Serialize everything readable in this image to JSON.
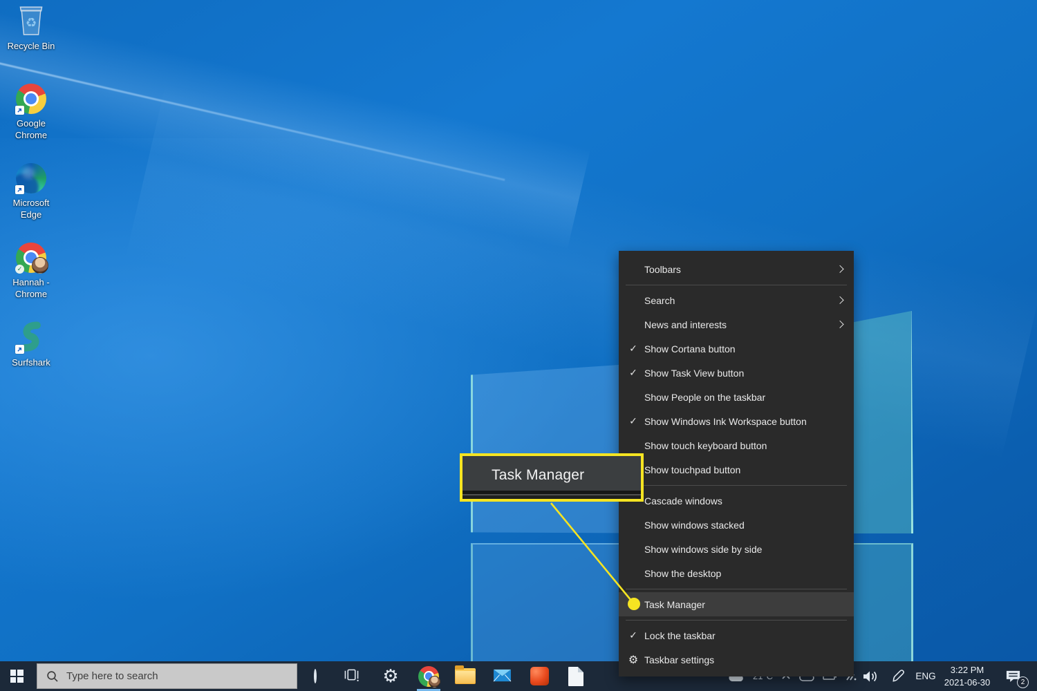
{
  "colors": {
    "accent_yellow": "#f5e422",
    "taskbar_bg": "#1c2939",
    "menu_bg": "#2a2a2a",
    "menu_highlight": "#3d3d3d",
    "active_app_indicator": "#76b9ed"
  },
  "desktop": {
    "icons": [
      {
        "name": "recycle-bin",
        "label": "Recycle Bin",
        "icon": "recycle-bin",
        "overlays": []
      },
      {
        "name": "google-chrome",
        "label": "Google Chrome",
        "icon": "chrome",
        "overlays": [
          "shortcut"
        ]
      },
      {
        "name": "microsoft-edge",
        "label": "Microsoft Edge",
        "icon": "edge",
        "overlays": [
          "shortcut"
        ]
      },
      {
        "name": "hannah-chrome",
        "label": "Hannah - Chrome",
        "icon": "chrome-profile",
        "overlays": [
          "check"
        ]
      },
      {
        "name": "surfshark",
        "label": "Surfshark",
        "icon": "surfshark",
        "overlays": [
          "shortcut"
        ]
      }
    ]
  },
  "callout": {
    "label": "Task Manager"
  },
  "context_menu": {
    "items": [
      {
        "label": "Toolbars",
        "submenu": true
      },
      {
        "separator": true
      },
      {
        "label": "Search",
        "submenu": true
      },
      {
        "label": "News and interests",
        "submenu": true
      },
      {
        "label": "Show Cortana button",
        "checked": true
      },
      {
        "label": "Show Task View button",
        "checked": true
      },
      {
        "label": "Show People on the taskbar"
      },
      {
        "label": "Show Windows Ink Workspace button",
        "checked": true
      },
      {
        "label": "Show touch keyboard button"
      },
      {
        "label": "Show touchpad button"
      },
      {
        "separator": true
      },
      {
        "label": "Cascade windows"
      },
      {
        "label": "Show windows stacked"
      },
      {
        "label": "Show windows side by side"
      },
      {
        "label": "Show the desktop"
      },
      {
        "separator": true
      },
      {
        "label": "Task Manager",
        "highlighted": true,
        "bullet": true
      },
      {
        "separator": true
      },
      {
        "label": "Lock the taskbar",
        "checked": true
      },
      {
        "label": "Taskbar settings",
        "gear": true
      }
    ]
  },
  "taskbar": {
    "start_icon": "windows-logo",
    "search": {
      "placeholder": "Type here to search",
      "icon": "search"
    },
    "apps": [
      {
        "name": "cortana",
        "icon": "cortana"
      },
      {
        "name": "task-view",
        "icon": "task-view"
      },
      {
        "name": "settings",
        "icon": "gear"
      },
      {
        "name": "chrome",
        "icon": "chrome-profile",
        "active": true
      },
      {
        "name": "file-explorer",
        "icon": "folder"
      },
      {
        "name": "mail",
        "icon": "mail"
      },
      {
        "name": "office",
        "icon": "office"
      },
      {
        "name": "word",
        "icon": "document"
      }
    ],
    "tray": {
      "weather_temp": "21°C",
      "peek_icons": [
        "weather-cloud",
        "chevron-up",
        "onedrive-cloud",
        "battery",
        "network"
      ],
      "icons": [
        "volume",
        "windows-ink-pen"
      ],
      "language": "ENG",
      "time": "3:22 PM",
      "date": "2021-06-30",
      "notification_badge": "2"
    }
  }
}
